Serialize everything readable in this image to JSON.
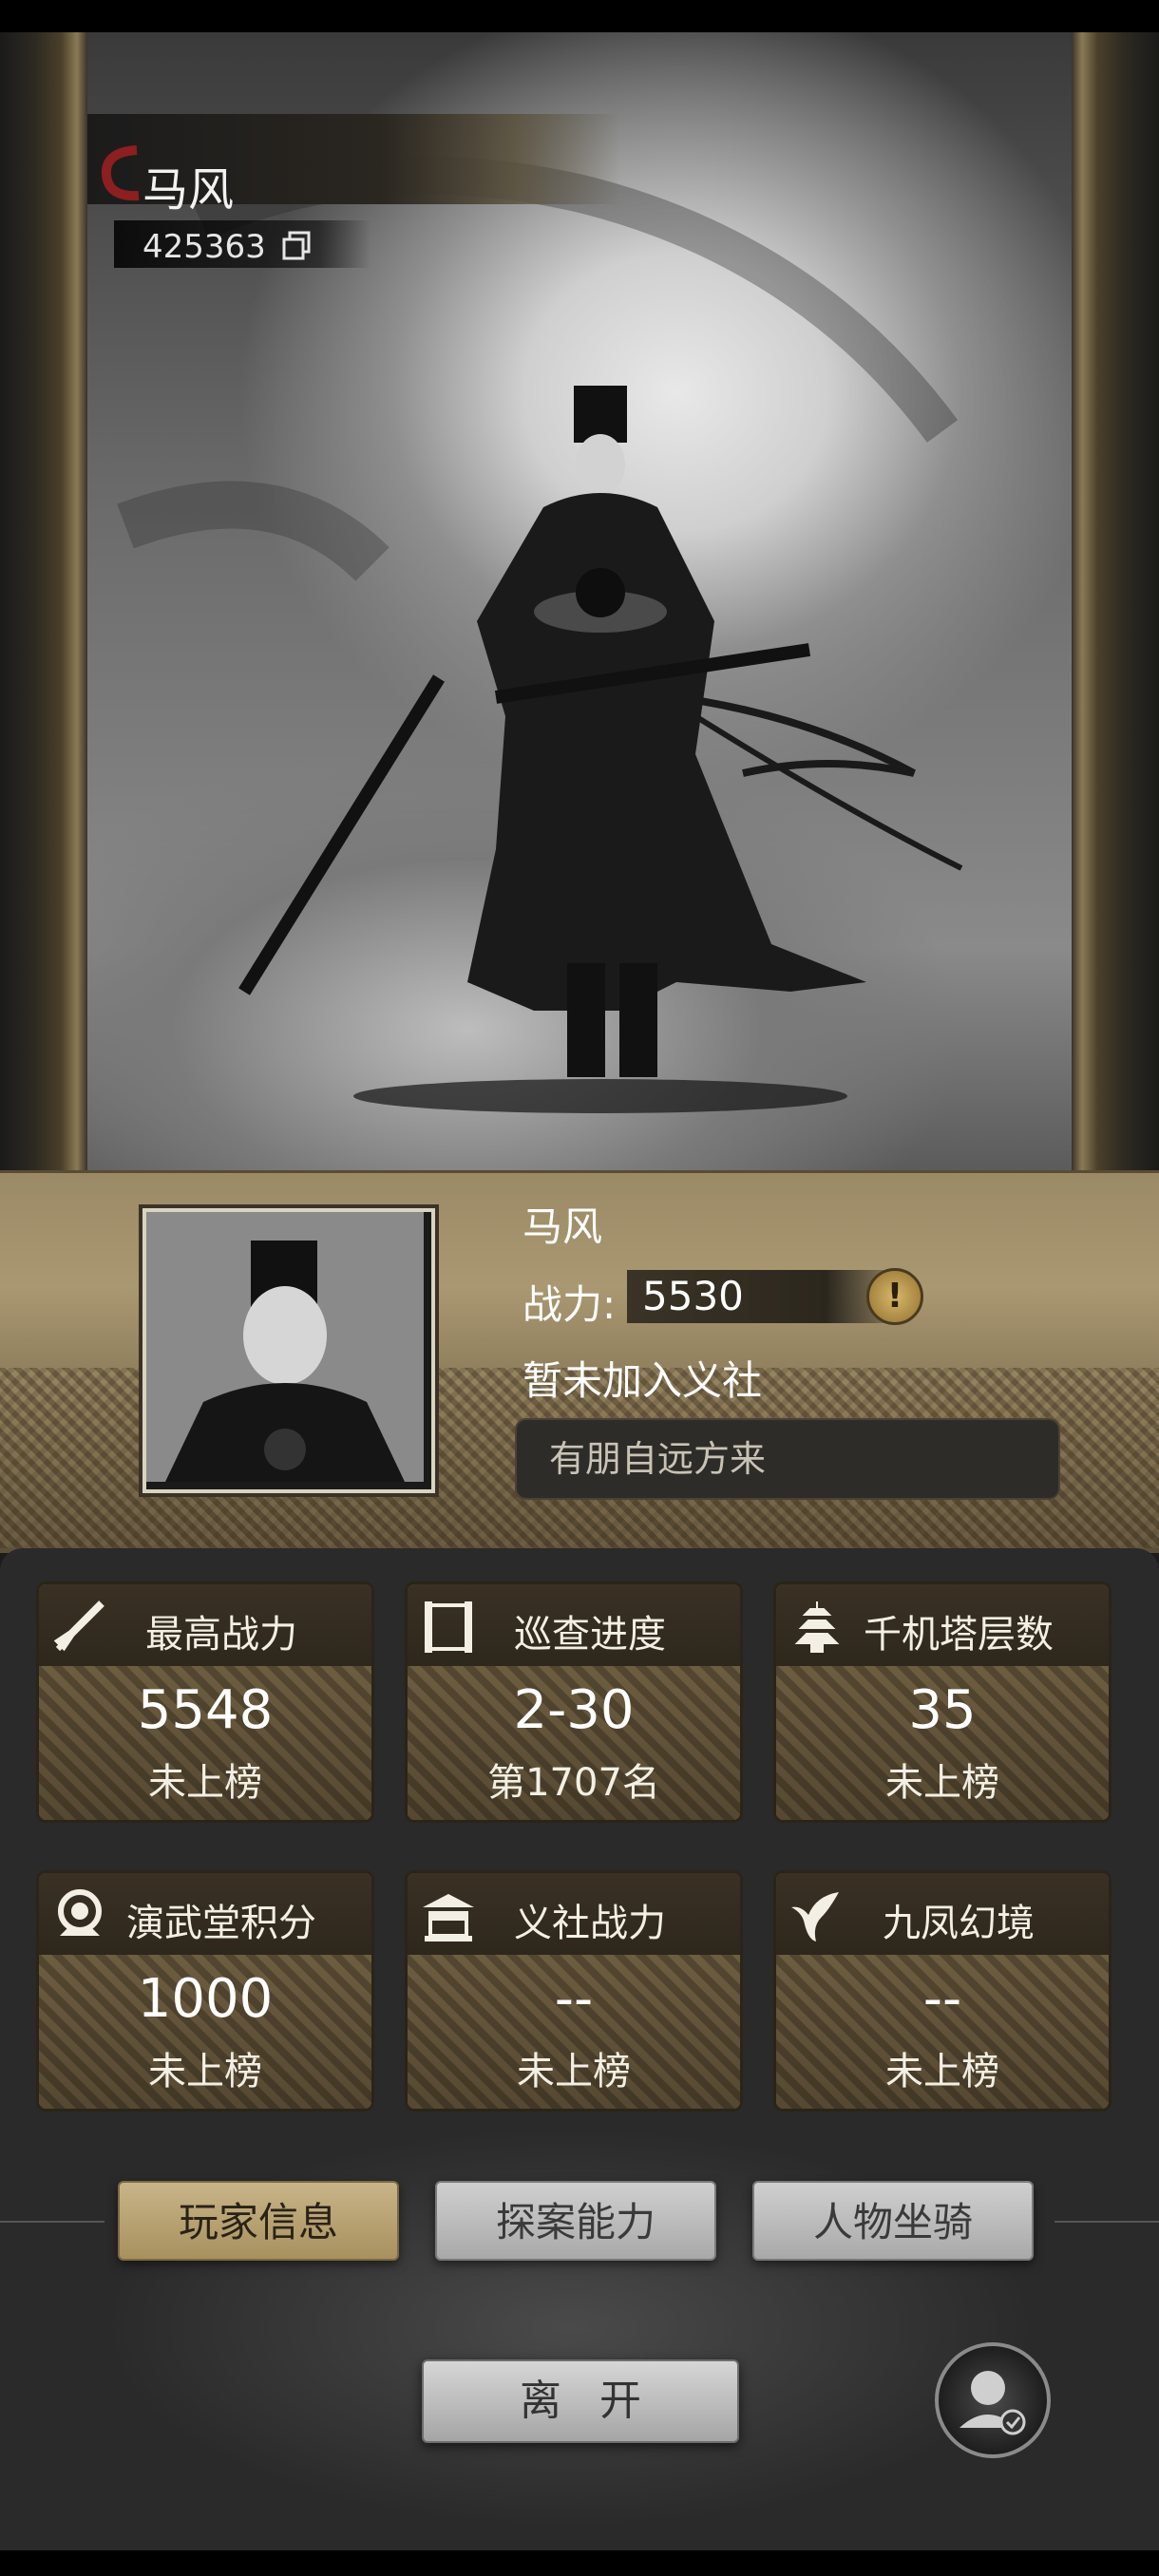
{
  "player": {
    "name": "马风",
    "id": "425363",
    "power_label": "战力:",
    "power_value": "5530",
    "guild_status": "暂未加入义社",
    "motto": "有朋自远方来"
  },
  "stats": [
    {
      "icon": "sword-icon",
      "title": "最高战力",
      "value": "5548",
      "sub": "未上榜"
    },
    {
      "icon": "scroll-icon",
      "title": "巡查进度",
      "value": "2-30",
      "sub": "第1707名"
    },
    {
      "icon": "pagoda-icon",
      "title": "千机塔层数",
      "value": "35",
      "sub": "未上榜"
    },
    {
      "icon": "medal-icon",
      "title": "演武堂积分",
      "value": "1000",
      "sub": "未上榜"
    },
    {
      "icon": "hall-icon",
      "title": "义社战力",
      "value": "--",
      "sub": "未上榜"
    },
    {
      "icon": "phoenix-icon",
      "title": "九凤幻境",
      "value": "--",
      "sub": "未上榜"
    }
  ],
  "tabs": [
    {
      "label": "玩家信息",
      "active": true
    },
    {
      "label": "探案能力",
      "active": false
    },
    {
      "label": "人物坐骑",
      "active": false
    }
  ],
  "leave_label": "离开",
  "colors": {
    "gold_plate": "#a99871",
    "card_head": "#3a3124",
    "active_tab": "#c8b488"
  }
}
